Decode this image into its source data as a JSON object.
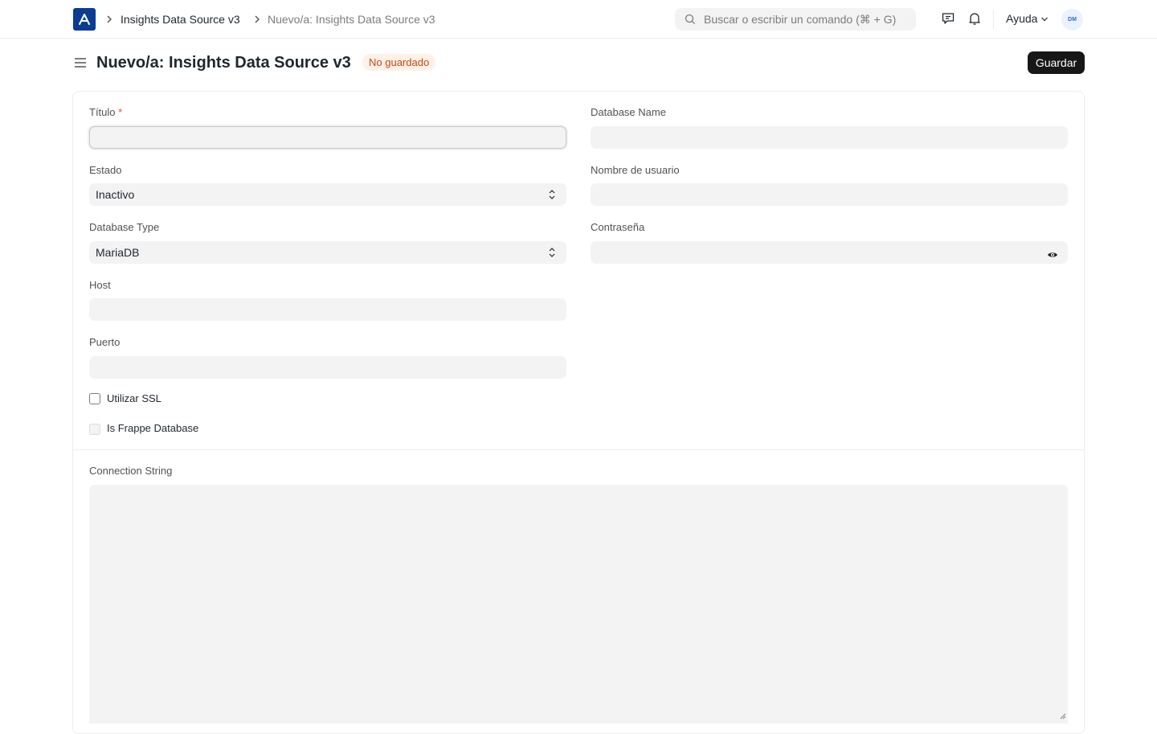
{
  "navbar": {
    "breadcrumbs": [
      {
        "label": "Insights Data Source v3"
      },
      {
        "label": "Nuevo/a: Insights Data Source v3"
      }
    ],
    "search_placeholder": "Buscar o escribir un comando (⌘ + G)",
    "help_label": "Ayuda",
    "avatar_text": "DM"
  },
  "page": {
    "title": "Nuevo/a: Insights Data Source v3",
    "status_indicator": "No guardado",
    "save_label": "Guardar"
  },
  "form": {
    "left": {
      "title_label": "Título",
      "title_required": "*",
      "title_value": "",
      "status_label": "Estado",
      "status_value": "Inactivo",
      "database_type_label": "Database Type",
      "database_type_value": "MariaDB",
      "host_label": "Host",
      "host_value": "",
      "port_label": "Puerto",
      "port_value": "",
      "use_ssl_label": "Utilizar SSL",
      "use_ssl_checked": false,
      "is_frappe_label": "Is Frappe Database",
      "is_frappe_checked": false
    },
    "right": {
      "database_name_label": "Database Name",
      "database_name_value": "",
      "username_label": "Nombre de usuario",
      "username_value": "",
      "password_label": "Contraseña",
      "password_value": ""
    },
    "connection": {
      "connection_string_label": "Connection String",
      "connection_string_value": ""
    }
  },
  "colors": {
    "primary_button": "#171717",
    "indicator_bg": "#fff1e7",
    "indicator_text": "#c4490f",
    "field_bg": "#f3f3f3",
    "logo_bg": "#0b3d91"
  },
  "icons": {
    "logo": "app-logo-icon",
    "search": "search-icon",
    "chat": "chat-icon",
    "notifications": "bell-icon",
    "menu": "hamburger-icon",
    "select_arrow": "updown-chevron-icon",
    "password_toggle": "eye-icon"
  }
}
